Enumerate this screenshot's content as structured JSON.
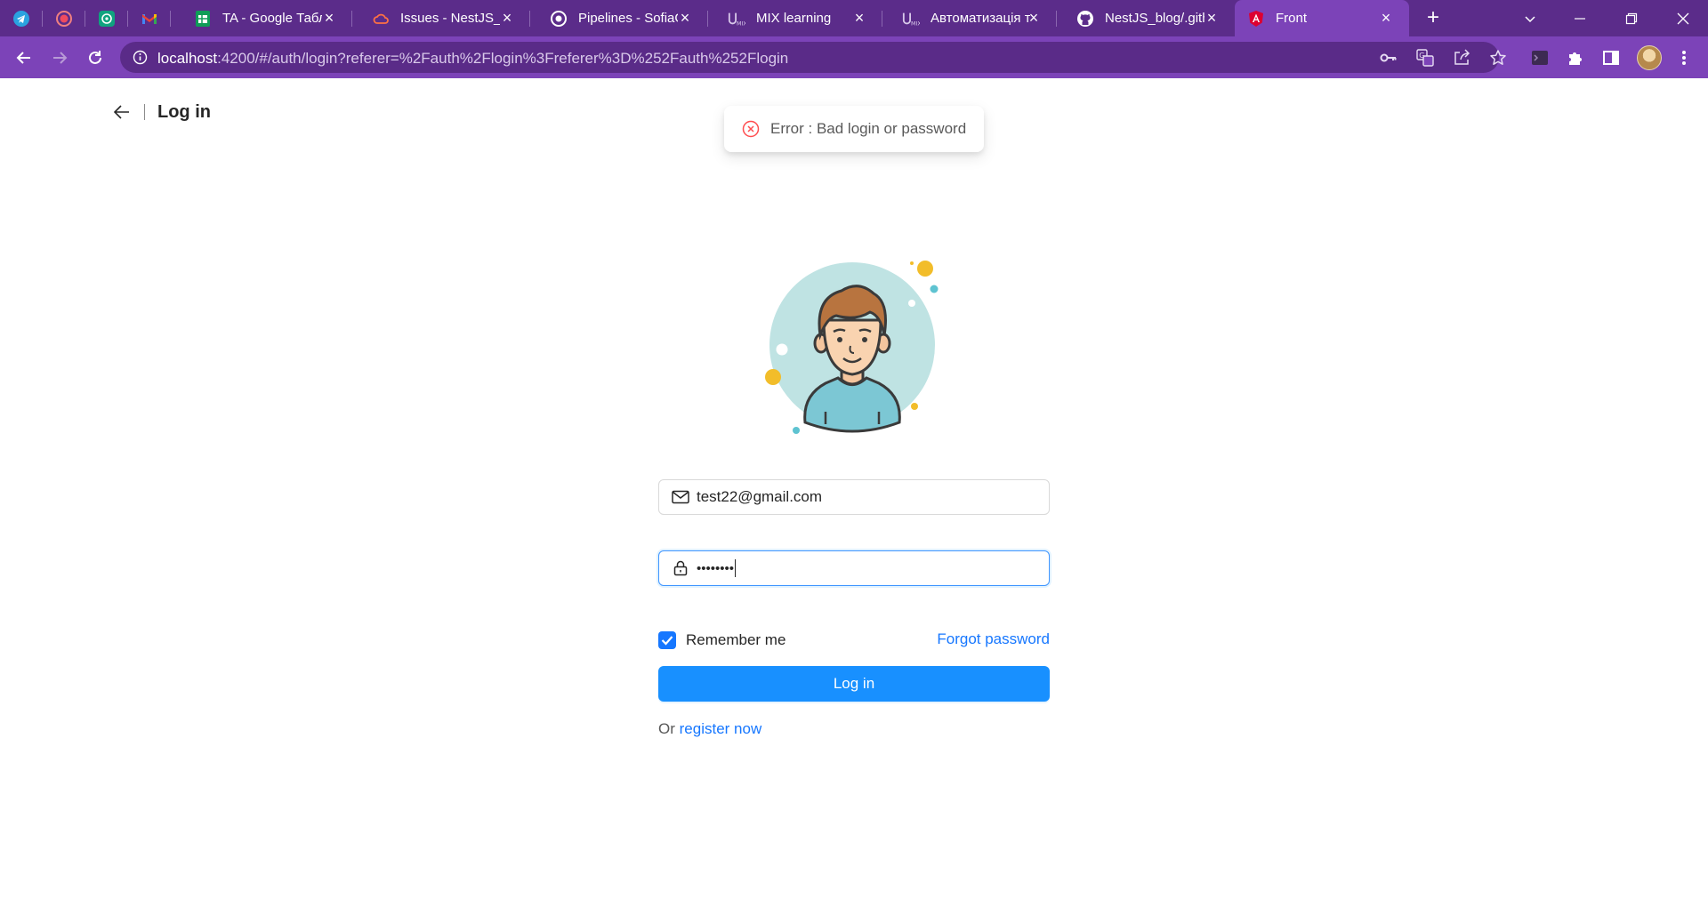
{
  "browser": {
    "tabs": [
      {
        "title": "",
        "icon": "telegram-icon",
        "pinned": true
      },
      {
        "title": "",
        "icon": "record-icon",
        "pinned": true
      },
      {
        "title": "",
        "icon": "chatgpt-icon",
        "pinned": true
      },
      {
        "title": "",
        "icon": "gmail-icon",
        "pinned": true
      },
      {
        "title": "TA - Google Табл",
        "icon": "google-sheets-icon"
      },
      {
        "title": "Issues - NestJS_bl",
        "icon": "cloud-icon"
      },
      {
        "title": "Pipelines - SofiaG",
        "icon": "pipeline-icon"
      },
      {
        "title": "MIX learning",
        "icon": "umix-icon"
      },
      {
        "title": "Автоматизація те",
        "icon": "umix-icon"
      },
      {
        "title": "NestJS_blog/.gith",
        "icon": "github-icon"
      },
      {
        "title": "Front",
        "icon": "angular-icon",
        "active": true
      }
    ],
    "url_host": "localhost",
    "url_rest": ":4200/#/auth/login?referer=%2Fauth%2Flogin%3Freferer%3D%252Fauth%252Flogin"
  },
  "header": {
    "title": "Log in"
  },
  "toast": {
    "message": "Error : Bad login or password",
    "icon": "close-circle-icon"
  },
  "form": {
    "email_value": "test22@gmail.com",
    "password_masked": "••••••••",
    "remember_label": "Remember me",
    "remember_checked": true,
    "forgot_label": "Forgot password",
    "submit_label": "Log in",
    "register_prefix": "Or",
    "register_link": "register now"
  },
  "colors": {
    "primary": "#1890ff",
    "link": "#1677ff",
    "error": "#ff4d4f",
    "chrome_frame": "#5b2c8a",
    "chrome_toolbar": "#7c43b8"
  }
}
